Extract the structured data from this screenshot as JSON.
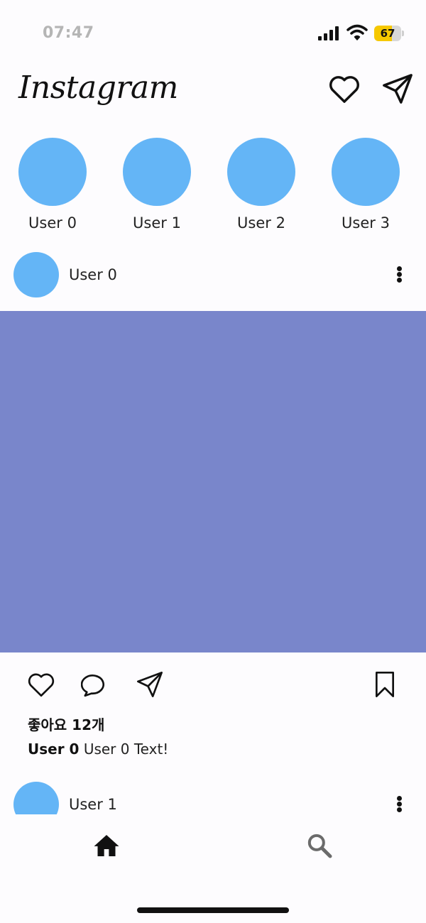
{
  "status_bar": {
    "time": "07:47",
    "battery_level": "67",
    "battery_fill_fraction": 0.67,
    "battery_color": "#f6c800",
    "icons": [
      "signal-icon",
      "wifi-icon",
      "battery-charging-icon"
    ]
  },
  "header": {
    "logo": "Instagram",
    "icons": [
      "heart-icon",
      "send-icon"
    ]
  },
  "stories": [
    {
      "name": "User 0"
    },
    {
      "name": "User 1"
    },
    {
      "name": "User 2"
    },
    {
      "name": "User 3"
    }
  ],
  "colors": {
    "avatar": "#64b5f6",
    "post_image": "#7986cb"
  },
  "posts": [
    {
      "user": "User 0",
      "likes": "좋아요 12개",
      "caption_user": "User 0",
      "caption_text": "User 0 Text!"
    },
    {
      "user": "User 1"
    }
  ],
  "post_actions": [
    "heart-icon",
    "comment-icon",
    "send-icon",
    "bookmark-icon"
  ],
  "bottom_nav": {
    "items": [
      {
        "icon": "home-icon",
        "selected": true
      },
      {
        "icon": "search-icon",
        "selected": false
      }
    ]
  }
}
